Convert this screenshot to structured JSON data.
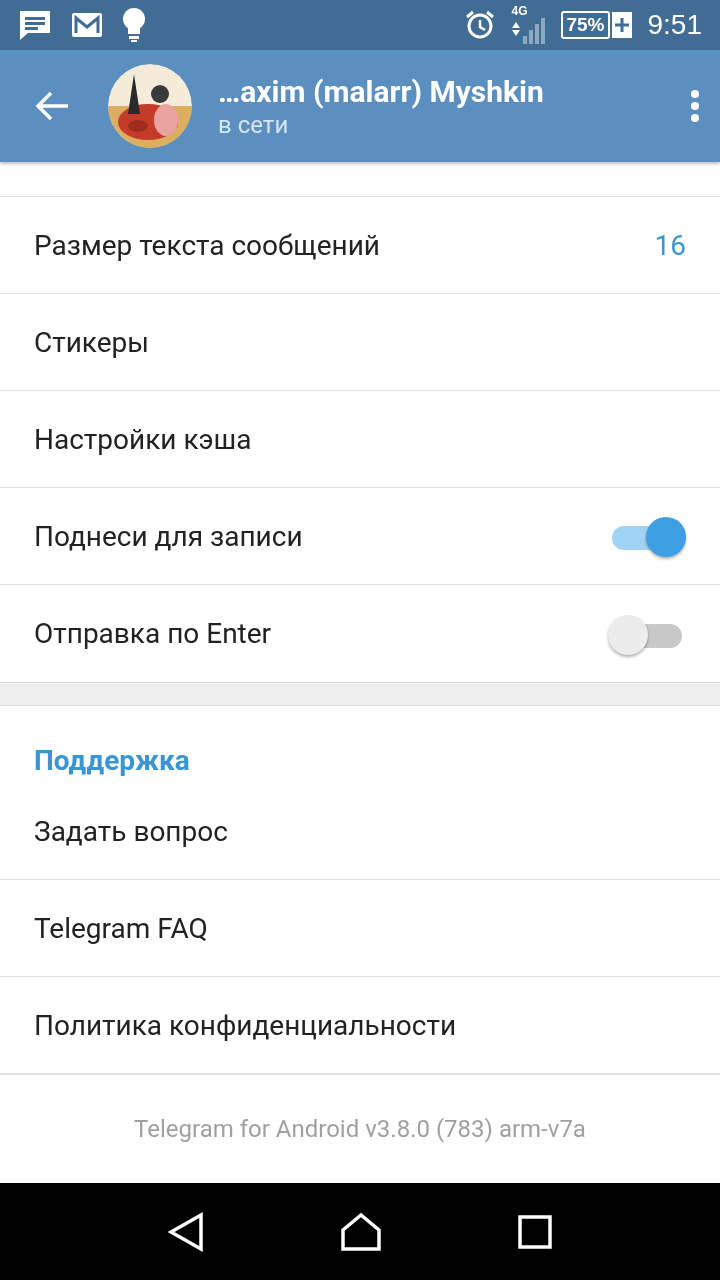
{
  "status_bar": {
    "network": "4G",
    "battery": "75%",
    "time": "9:51"
  },
  "header": {
    "title": "…axim (malarr) Myshkin",
    "subtitle": "в сети"
  },
  "settings": [
    {
      "kind": "value",
      "label": "Размер текста сообщений",
      "value": "16"
    },
    {
      "kind": "plain",
      "label": "Стикеры"
    },
    {
      "kind": "plain",
      "label": "Настройки кэша"
    },
    {
      "kind": "toggle",
      "label": "Поднеси для записи",
      "on": true
    },
    {
      "kind": "toggle",
      "label": "Отправка по Enter",
      "on": false
    }
  ],
  "support": {
    "title": "Поддержка",
    "items": [
      {
        "label": "Задать вопрос"
      },
      {
        "label": "Telegram FAQ"
      },
      {
        "label": "Политика конфиденциальности"
      }
    ]
  },
  "footer": "Telegram for Android v3.8.0 (783) arm-v7a"
}
